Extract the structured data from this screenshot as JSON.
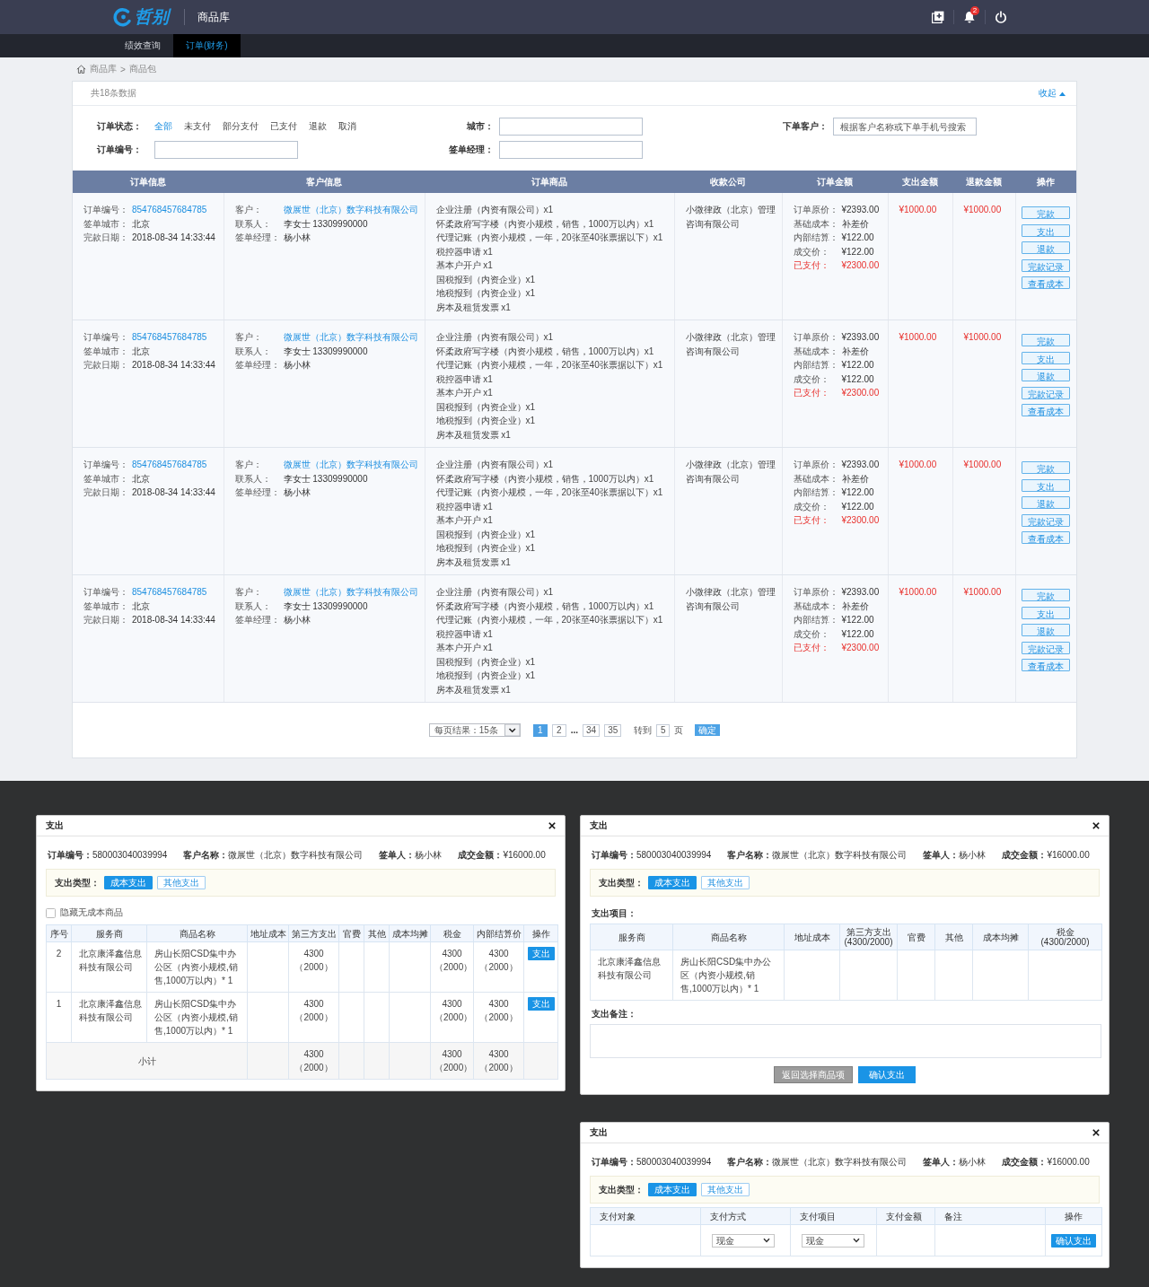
{
  "top_bar": {
    "logo_text": "哲别",
    "title": "商品库",
    "notification_count": "2"
  },
  "nav_tabs": [
    {
      "label": "绩效查询",
      "selected": false
    },
    {
      "label": "订单(财务)",
      "selected": true
    }
  ],
  "breadcrumb": {
    "items": [
      "商品库",
      "商品包"
    ],
    "separator": ">"
  },
  "order_panel": {
    "count_text": "共18条数据",
    "collapse_label": "收起",
    "filters": [
      {
        "kind": "options",
        "label": "订单状态：",
        "options": [
          {
            "label": "全部",
            "selected": true
          },
          {
            "label": "未支付",
            "selected": false
          },
          {
            "label": "部分支付",
            "selected": false
          },
          {
            "label": "已支付",
            "selected": false
          },
          {
            "label": "退款",
            "selected": false
          },
          {
            "label": "取消",
            "selected": false
          }
        ]
      },
      {
        "kind": "input",
        "label": "城市："
      },
      {
        "kind": "input",
        "label": "下单客户：",
        "placeholder": "根据客户名称或下单手机号搜索"
      },
      {
        "kind": "input",
        "label": "订单编号："
      },
      {
        "kind": "input",
        "label": "签单经理："
      }
    ],
    "columns": [
      "订单信息",
      "客户信息",
      "订单商品",
      "收款公司",
      "订单金额",
      "支出金额",
      "退款金额",
      "操作"
    ],
    "rows": [
      {
        "order_info": [
          {
            "label": "订单编号：",
            "value": "854768457684785",
            "kind": "link"
          },
          {
            "label": "签单城市：",
            "value": "北京",
            "kind": "text"
          },
          {
            "label": "完款日期：",
            "value": "2018-08-34 14:33:44",
            "kind": "text"
          }
        ],
        "customer_info": [
          {
            "label": "客户：",
            "value": "微展世（北京）数字科技有限公司",
            "kind": "link"
          },
          {
            "label": "联系人：",
            "value": "李女士 13309990000",
            "kind": "text"
          },
          {
            "label": "签单经理：",
            "value": "杨小林",
            "kind": "text"
          }
        ],
        "products": [
          "企业注册（内资有限公司）x1",
          "怀柔政府写字楼（内资小规模，销售，1000万以内）x1",
          "代理记账（内资小规模，一年，20张至40张票据以下）x1",
          "税控器申请 x1",
          "基本户开户 x1",
          "国税报到（内资企业）x1",
          "地税报到（内资企业）x1",
          "房本及租赁发票 x1"
        ],
        "payee_company": "小微律政（北京）管理咨询有限公司",
        "amounts": [
          {
            "label": "订单原价：",
            "value": "¥2393.00",
            "kind": "text"
          },
          {
            "label": "基础成本：",
            "value": "补差价",
            "kind": "text"
          },
          {
            "label": "内部结算：",
            "value": "¥122.00",
            "kind": "text"
          },
          {
            "label": "成交价：",
            "value": "¥122.00",
            "kind": "text"
          },
          {
            "label": "已支付：",
            "value": "¥2300.00",
            "kind": "alert"
          }
        ],
        "payout": "¥1000.00",
        "refund": "¥1000.00",
        "actions": [
          "完款",
          "支出",
          "退款",
          "完款记录",
          "查看成本"
        ]
      },
      {
        "order_info": [
          {
            "label": "订单编号：",
            "value": "854768457684785",
            "kind": "link"
          },
          {
            "label": "签单城市：",
            "value": "北京",
            "kind": "text"
          },
          {
            "label": "完款日期：",
            "value": "2018-08-34 14:33:44",
            "kind": "text"
          }
        ],
        "customer_info": [
          {
            "label": "客户：",
            "value": "微展世（北京）数字科技有限公司",
            "kind": "link"
          },
          {
            "label": "联系人：",
            "value": "李女士 13309990000",
            "kind": "text"
          },
          {
            "label": "签单经理：",
            "value": "杨小林",
            "kind": "text"
          }
        ],
        "products": [
          "企业注册（内资有限公司）x1",
          "怀柔政府写字楼（内资小规模，销售，1000万以内）x1",
          "代理记账（内资小规模，一年，20张至40张票据以下）x1",
          "税控器申请 x1",
          "基本户开户 x1",
          "国税报到（内资企业）x1",
          "地税报到（内资企业）x1",
          "房本及租赁发票 x1"
        ],
        "payee_company": "小微律政（北京）管理咨询有限公司",
        "amounts": [
          {
            "label": "订单原价：",
            "value": "¥2393.00",
            "kind": "text"
          },
          {
            "label": "基础成本：",
            "value": "补差价",
            "kind": "text"
          },
          {
            "label": "内部结算：",
            "value": "¥122.00",
            "kind": "text"
          },
          {
            "label": "成交价：",
            "value": "¥122.00",
            "kind": "text"
          },
          {
            "label": "已支付：",
            "value": "¥2300.00",
            "kind": "alert"
          }
        ],
        "payout": "¥1000.00",
        "refund": "¥1000.00",
        "actions": [
          "完款",
          "支出",
          "退款",
          "完款记录",
          "查看成本"
        ]
      },
      {
        "order_info": [
          {
            "label": "订单编号：",
            "value": "854768457684785",
            "kind": "link"
          },
          {
            "label": "签单城市：",
            "value": "北京",
            "kind": "text"
          },
          {
            "label": "完款日期：",
            "value": "2018-08-34 14:33:44",
            "kind": "text"
          }
        ],
        "customer_info": [
          {
            "label": "客户：",
            "value": "微展世（北京）数字科技有限公司",
            "kind": "link"
          },
          {
            "label": "联系人：",
            "value": "李女士 13309990000",
            "kind": "text"
          },
          {
            "label": "签单经理：",
            "value": "杨小林",
            "kind": "text"
          }
        ],
        "products": [
          "企业注册（内资有限公司）x1",
          "怀柔政府写字楼（内资小规模，销售，1000万以内）x1",
          "代理记账（内资小规模，一年，20张至40张票据以下）x1",
          "税控器申请 x1",
          "基本户开户 x1",
          "国税报到（内资企业）x1",
          "地税报到（内资企业）x1",
          "房本及租赁发票 x1"
        ],
        "payee_company": "小微律政（北京）管理咨询有限公司",
        "amounts": [
          {
            "label": "订单原价：",
            "value": "¥2393.00",
            "kind": "text"
          },
          {
            "label": "基础成本：",
            "value": "补差价",
            "kind": "text"
          },
          {
            "label": "内部结算：",
            "value": "¥122.00",
            "kind": "text"
          },
          {
            "label": "成交价：",
            "value": "¥122.00",
            "kind": "text"
          },
          {
            "label": "已支付：",
            "value": "¥2300.00",
            "kind": "alert"
          }
        ],
        "payout": "¥1000.00",
        "refund": "¥1000.00",
        "actions": [
          "完款",
          "支出",
          "退款",
          "完款记录",
          "查看成本"
        ]
      },
      {
        "order_info": [
          {
            "label": "订单编号：",
            "value": "854768457684785",
            "kind": "link"
          },
          {
            "label": "签单城市：",
            "value": "北京",
            "kind": "text"
          },
          {
            "label": "完款日期：",
            "value": "2018-08-34 14:33:44",
            "kind": "text"
          }
        ],
        "customer_info": [
          {
            "label": "客户：",
            "value": "微展世（北京）数字科技有限公司",
            "kind": "link"
          },
          {
            "label": "联系人：",
            "value": "李女士 13309990000",
            "kind": "text"
          },
          {
            "label": "签单经理：",
            "value": "杨小林",
            "kind": "text"
          }
        ],
        "products": [
          "企业注册（内资有限公司）x1",
          "怀柔政府写字楼（内资小规模，销售，1000万以内）x1",
          "代理记账（内资小规模，一年，20张至40张票据以下）x1",
          "税控器申请 x1",
          "基本户开户 x1",
          "国税报到（内资企业）x1",
          "地税报到（内资企业）x1",
          "房本及租赁发票 x1"
        ],
        "payee_company": "小微律政（北京）管理咨询有限公司",
        "amounts": [
          {
            "label": "订单原价：",
            "value": "¥2393.00",
            "kind": "text"
          },
          {
            "label": "基础成本：",
            "value": "补差价",
            "kind": "text"
          },
          {
            "label": "内部结算：",
            "value": "¥122.00",
            "kind": "text"
          },
          {
            "label": "成交价：",
            "value": "¥122.00",
            "kind": "text"
          },
          {
            "label": "已支付：",
            "value": "¥2300.00",
            "kind": "alert"
          }
        ],
        "payout": "¥1000.00",
        "refund": "¥1000.00",
        "actions": [
          "完款",
          "支出",
          "退款",
          "完款记录",
          "查看成本"
        ]
      }
    ],
    "pagination": {
      "page_size": "每页结果：15条",
      "pages": [
        {
          "label": "1",
          "kind": "page",
          "selected": true
        },
        {
          "label": "2",
          "kind": "page",
          "selected": false
        },
        {
          "label": "...",
          "kind": "gap",
          "selected": false
        },
        {
          "label": "34",
          "kind": "page",
          "selected": false
        },
        {
          "label": "35",
          "kind": "page",
          "selected": false
        }
      ],
      "goto_label": "转到",
      "goto_value": "5",
      "goto_unit": "页",
      "confirm_label": "确定"
    }
  },
  "modals": [
    {
      "kind": "cost_list",
      "title": "支出",
      "summary": [
        {
          "label": "订单编号：",
          "value": "580003040039994"
        },
        {
          "label": "客户名称：",
          "value": "微展世（北京）数字科技有限公司"
        },
        {
          "label": "签单人：",
          "value": "杨小林"
        },
        {
          "label": "成交金额：",
          "value": "¥16000.00"
        }
      ],
      "expense_type": {
        "label": "支出类型：",
        "options": [
          {
            "label": "成本支出",
            "selected": true
          },
          {
            "label": "其他支出",
            "selected": false
          }
        ]
      },
      "checkbox": {
        "label": "隐藏无成本商品",
        "checked": false
      },
      "table": {
        "columns": [
          {
            "label": "序号"
          },
          {
            "label": "服务商"
          },
          {
            "label": "商品名称"
          },
          {
            "label": "地址成本"
          },
          {
            "label": "第三方支出"
          },
          {
            "label": "官费"
          },
          {
            "label": "其他"
          },
          {
            "label": "成本均摊"
          },
          {
            "label": "税金"
          },
          {
            "label": "内部结算价"
          },
          {
            "label": "操作"
          }
        ],
        "rows": [
          {
            "number": "2",
            "provider": "北京康泽鑫信息科技有限公司",
            "product": "房山长阳CSD集中办公区（内资小规模,销售,1000万以内）* 1",
            "third_party": [
              "4300",
              "（2000）"
            ],
            "tax": [
              "4300",
              "（2000）"
            ],
            "internal_price": [
              "4300",
              "（2000）"
            ],
            "action": "支出"
          },
          {
            "number": "1",
            "provider": "北京康泽鑫信息科技有限公司",
            "product": "房山长阳CSD集中办公区（内资小规模,销售,1000万以内）* 1",
            "third_party": [
              "4300",
              "（2000）"
            ],
            "tax": [
              "4300",
              "（2000）"
            ],
            "internal_price": [
              "4300",
              "（2000）"
            ],
            "action": "支出"
          }
        ],
        "subtotal": {
          "label": "小计",
          "third_party": [
            "4300",
            "（2000）"
          ],
          "tax": [
            "4300",
            "（2000）"
          ],
          "internal_price": [
            "4300",
            "（2000）"
          ]
        }
      }
    },
    {
      "kind": "cost_detail",
      "title": "支出",
      "summary": [
        {
          "label": "订单编号：",
          "value": "580003040039994"
        },
        {
          "label": "客户名称：",
          "value": "微展世（北京）数字科技有限公司"
        },
        {
          "label": "签单人：",
          "value": "杨小林"
        },
        {
          "label": "成交金额：",
          "value": "¥16000.00"
        }
      ],
      "expense_type": {
        "label": "支出类型：",
        "options": [
          {
            "label": "成本支出",
            "selected": true
          },
          {
            "label": "其他支出",
            "selected": false
          }
        ]
      },
      "items_label": "支出项目：",
      "table": {
        "columns": [
          {
            "label": "服务商"
          },
          {
            "label": "商品名称"
          },
          {
            "label": "地址成本"
          },
          {
            "label": "第三方支出",
            "sub": "(4300/2000)"
          },
          {
            "label": "官费"
          },
          {
            "label": "其他"
          },
          {
            "label": "成本均摊"
          },
          {
            "label": "税金",
            "sub": "(4300/2000)"
          }
        ],
        "rows": [
          {
            "provider": "北京康泽鑫信息科技有限公司",
            "product": "房山长阳CSD集中办公区（内资小规模,销售,1000万以内）* 1"
          }
        ]
      },
      "remark_label": "支出备注：",
      "buttons": [
        {
          "label": "返回选择商品项",
          "kind": "secondary"
        },
        {
          "label": "确认支出",
          "kind": "primary"
        }
      ]
    },
    {
      "kind": "payment",
      "title": "支出",
      "summary": [
        {
          "label": "订单编号：",
          "value": "580003040039994"
        },
        {
          "label": "客户名称：",
          "value": "微展世（北京）数字科技有限公司"
        },
        {
          "label": "签单人：",
          "value": "杨小林"
        },
        {
          "label": "成交金额：",
          "value": "¥16000.00"
        }
      ],
      "expense_type": {
        "label": "支出类型：",
        "options": [
          {
            "label": "成本支出",
            "selected": true
          },
          {
            "label": "其他支出",
            "selected": false
          }
        ]
      },
      "table": {
        "columns": [
          {
            "label": "支付对象"
          },
          {
            "label": "支付方式"
          },
          {
            "label": "支付项目"
          },
          {
            "label": "支付金额"
          },
          {
            "label": "备注"
          },
          {
            "label": "操作"
          }
        ],
        "rows": [
          {
            "method": "现金",
            "item": "现金",
            "action": "确认支出"
          }
        ]
      }
    }
  ]
}
